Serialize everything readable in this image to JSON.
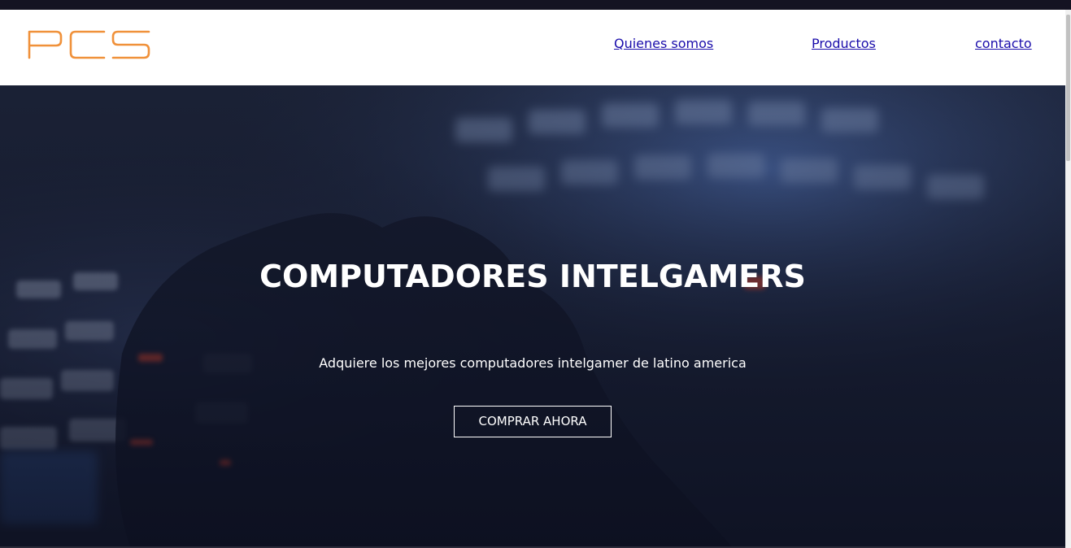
{
  "header": {
    "logo_text": "PCS",
    "logo_color": "#f0913a",
    "nav": [
      {
        "label": "Quienes somos"
      },
      {
        "label": "Productos"
      },
      {
        "label": "contacto"
      }
    ],
    "link_color": "#1a0dab"
  },
  "hero": {
    "title": "COMPUTADORES INTELGAMERS",
    "subtitle": "Adquiere los mejores computadores intelgamer de latino america",
    "button_label": "COMPRAR AHORA",
    "background_color": "#1b2033"
  }
}
